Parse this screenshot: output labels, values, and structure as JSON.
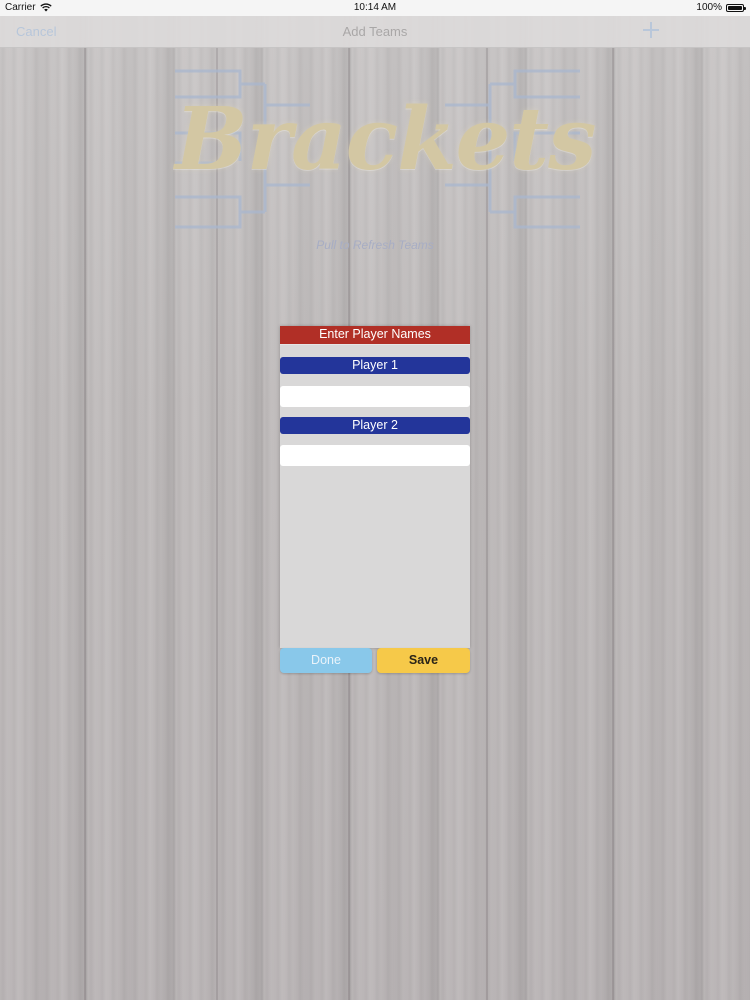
{
  "status_bar": {
    "carrier": "Carrier",
    "time": "10:14 AM",
    "battery": "100%"
  },
  "nav": {
    "cancel_label": "Cancel",
    "title": "Add Teams",
    "add_icon": "plus-icon"
  },
  "logo": {
    "text": "Brackets"
  },
  "refresh_hint": "Pull to Refresh Teams",
  "player_form": {
    "header": "Enter Player Names",
    "players": [
      {
        "label": "Player 1",
        "value": ""
      },
      {
        "label": "Player 2",
        "value": ""
      }
    ],
    "done_label": "Done",
    "save_label": "Save"
  },
  "colors": {
    "header_red": "#b12f26",
    "player_blue": "#23359a",
    "done_blue": "#89c8ea",
    "save_yellow": "#f6c949",
    "logo_gold": "#d3c7a3"
  }
}
